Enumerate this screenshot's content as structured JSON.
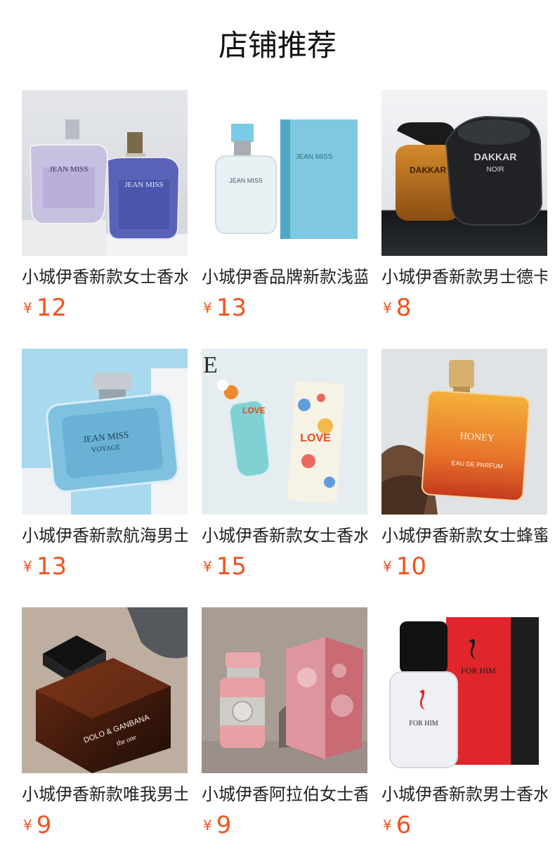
{
  "header": {
    "title": "店铺推荐"
  },
  "currency_symbol": "¥",
  "colors": {
    "price": "#f2521c",
    "text": "#222222"
  },
  "products": [
    {
      "name": "小城伊香新款女士香水",
      "price": "12",
      "image": "perfume-jean-miss-purple-pair"
    },
    {
      "name": "小城伊香品牌新款浅蓝",
      "price": "13",
      "image": "perfume-jean-miss-light-blue-with-box"
    },
    {
      "name": "小城伊香新款男士德卡",
      "price": "8",
      "image": "perfume-dakkar-pair"
    },
    {
      "name": "小城伊香新款航海男士",
      "price": "13",
      "image": "perfume-jean-miss-voyage"
    },
    {
      "name": "小城伊香新款女士香水",
      "price": "15",
      "image": "perfume-love-with-box"
    },
    {
      "name": "小城伊香新款女士蜂蜜",
      "price": "10",
      "image": "perfume-mood-amor-honey"
    },
    {
      "name": "小城伊香新款唯我男士",
      "price": "9",
      "image": "perfume-dolo-ganbana-the-one"
    },
    {
      "name": "小城伊香阿拉伯女士香",
      "price": "9",
      "image": "perfume-arabic-pink-with-box"
    },
    {
      "name": "小城伊香新款男士香水",
      "price": "6",
      "image": "perfume-for-him-with-box"
    }
  ],
  "image_labels": {
    "p1_brand": "JEAN MISS",
    "p2_brand": "JEAN MISS",
    "p3_brand": "DAKKAR",
    "p3_sub": "NOIR",
    "p4_brand": "JEAN MISS",
    "p4_sub": "VOYAGE",
    "p5_brand": "LOVE",
    "p6_brand": "HONEY",
    "p6_sub": "EAU DE PARFUM",
    "p7_brand": "DOLO & GANBANA",
    "p7_sub": "the one",
    "p9_brand": "FOR HIM"
  }
}
